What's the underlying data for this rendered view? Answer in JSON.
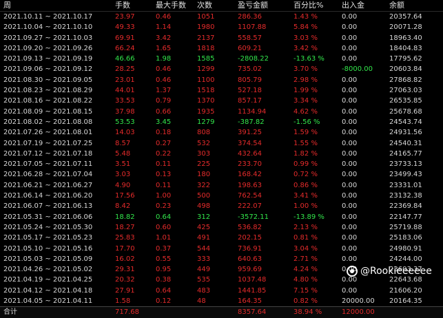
{
  "headers": [
    "周",
    "手数",
    "最大手数",
    "次数",
    "盈亏金额",
    "百分比%",
    "出入金",
    "余额"
  ],
  "rows": [
    {
      "week": "2021.10.11 ~ 2021.10.17",
      "lots": "23.97",
      "max": "0.46",
      "count": "1051",
      "pnl": "286.36",
      "pct": "1.43 %",
      "io": "0.00",
      "bal": "20357.64",
      "color": "red"
    },
    {
      "week": "2021.10.04 ~ 2021.10.10",
      "lots": "49.33",
      "max": "1.14",
      "count": "1980",
      "pnl": "1107.88",
      "pct": "5.84 %",
      "io": "0.00",
      "bal": "20071.28",
      "color": "red"
    },
    {
      "week": "2021.09.27 ~ 2021.10.03",
      "lots": "69.91",
      "max": "3.42",
      "count": "2137",
      "pnl": "558.57",
      "pct": "3.03 %",
      "io": "0.00",
      "bal": "18963.40",
      "color": "red"
    },
    {
      "week": "2021.09.20 ~ 2021.09.26",
      "lots": "66.24",
      "max": "1.65",
      "count": "1818",
      "pnl": "609.21",
      "pct": "3.42 %",
      "io": "0.00",
      "bal": "18404.83",
      "color": "red"
    },
    {
      "week": "2021.09.13 ~ 2021.09.19",
      "lots": "46.66",
      "max": "1.98",
      "count": "1585",
      "pnl": "-2808.22",
      "pct": "-13.63 %",
      "io": "0.00",
      "bal": "17795.62",
      "color": "green"
    },
    {
      "week": "2021.09.06 ~ 2021.09.12",
      "lots": "28.25",
      "max": "0.46",
      "count": "1299",
      "pnl": "735.02",
      "pct": "3.70 %",
      "io": "-8000.00",
      "bal": "20603.84",
      "color": "red",
      "io_color": "green"
    },
    {
      "week": "2021.08.30 ~ 2021.09.05",
      "lots": "23.01",
      "max": "0.46",
      "count": "1100",
      "pnl": "805.79",
      "pct": "2.98 %",
      "io": "0.00",
      "bal": "27868.82",
      "color": "red"
    },
    {
      "week": "2021.08.23 ~ 2021.08.29",
      "lots": "44.01",
      "max": "1.37",
      "count": "1518",
      "pnl": "527.18",
      "pct": "1.99 %",
      "io": "0.00",
      "bal": "27063.03",
      "color": "red"
    },
    {
      "week": "2021.08.16 ~ 2021.08.22",
      "lots": "33.53",
      "max": "0.79",
      "count": "1370",
      "pnl": "857.17",
      "pct": "3.34 %",
      "io": "0.00",
      "bal": "26535.85",
      "color": "red"
    },
    {
      "week": "2021.08.09 ~ 2021.08.15",
      "lots": "37.98",
      "max": "0.66",
      "count": "1935",
      "pnl": "1134.94",
      "pct": "4.62 %",
      "io": "0.00",
      "bal": "25678.68",
      "color": "red"
    },
    {
      "week": "2021.08.02 ~ 2021.08.08",
      "lots": "53.53",
      "max": "3.45",
      "count": "1279",
      "pnl": "-387.82",
      "pct": "-1.56 %",
      "io": "0.00",
      "bal": "24543.74",
      "color": "green"
    },
    {
      "week": "2021.07.26 ~ 2021.08.01",
      "lots": "14.03",
      "max": "0.18",
      "count": "808",
      "pnl": "391.25",
      "pct": "1.59 %",
      "io": "0.00",
      "bal": "24931.56",
      "color": "red"
    },
    {
      "week": "2021.07.19 ~ 2021.07.25",
      "lots": "8.57",
      "max": "0.27",
      "count": "532",
      "pnl": "374.54",
      "pct": "1.55 %",
      "io": "0.00",
      "bal": "24540.31",
      "color": "red"
    },
    {
      "week": "2021.07.12 ~ 2021.07.18",
      "lots": "5.48",
      "max": "0.22",
      "count": "303",
      "pnl": "432.64",
      "pct": "1.82 %",
      "io": "0.00",
      "bal": "24165.77",
      "color": "red"
    },
    {
      "week": "2021.07.05 ~ 2021.07.11",
      "lots": "3.51",
      "max": "0.11",
      "count": "225",
      "pnl": "233.70",
      "pct": "0.99 %",
      "io": "0.00",
      "bal": "23733.13",
      "color": "red"
    },
    {
      "week": "2021.06.28 ~ 2021.07.04",
      "lots": "3.03",
      "max": "0.13",
      "count": "180",
      "pnl": "168.42",
      "pct": "0.72 %",
      "io": "0.00",
      "bal": "23499.43",
      "color": "red"
    },
    {
      "week": "2021.06.21 ~ 2021.06.27",
      "lots": "4.90",
      "max": "0.11",
      "count": "322",
      "pnl": "198.63",
      "pct": "0.86 %",
      "io": "0.00",
      "bal": "23331.01",
      "color": "red"
    },
    {
      "week": "2021.06.14 ~ 2021.06.20",
      "lots": "17.56",
      "max": "1.00",
      "count": "500",
      "pnl": "762.54",
      "pct": "3.41 %",
      "io": "0.00",
      "bal": "23132.38",
      "color": "red"
    },
    {
      "week": "2021.06.07 ~ 2021.06.13",
      "lots": "8.42",
      "max": "0.23",
      "count": "498",
      "pnl": "222.07",
      "pct": "1.00 %",
      "io": "0.00",
      "bal": "22369.84",
      "color": "red"
    },
    {
      "week": "2021.05.31 ~ 2021.06.06",
      "lots": "18.82",
      "max": "0.64",
      "count": "312",
      "pnl": "-3572.11",
      "pct": "-13.89 %",
      "io": "0.00",
      "bal": "22147.77",
      "color": "green"
    },
    {
      "week": "2021.05.24 ~ 2021.05.30",
      "lots": "18.27",
      "max": "0.60",
      "count": "425",
      "pnl": "536.82",
      "pct": "2.13 %",
      "io": "0.00",
      "bal": "25719.88",
      "color": "red"
    },
    {
      "week": "2021.05.17 ~ 2021.05.23",
      "lots": "25.83",
      "max": "1.01",
      "count": "491",
      "pnl": "202.15",
      "pct": "0.81 %",
      "io": "0.00",
      "bal": "25183.06",
      "color": "red"
    },
    {
      "week": "2021.05.10 ~ 2021.05.16",
      "lots": "17.70",
      "max": "0.37",
      "count": "544",
      "pnl": "736.91",
      "pct": "3.04 %",
      "io": "0.00",
      "bal": "24980.91",
      "color": "red"
    },
    {
      "week": "2021.05.03 ~ 2021.05.09",
      "lots": "16.02",
      "max": "0.55",
      "count": "333",
      "pnl": "640.63",
      "pct": "2.71 %",
      "io": "0.00",
      "bal": "24244.00",
      "color": "red"
    },
    {
      "week": "2021.04.26 ~ 2021.05.02",
      "lots": "29.31",
      "max": "0.95",
      "count": "449",
      "pnl": "959.69",
      "pct": "4.24 %",
      "io": "0.00",
      "bal": "23603.37",
      "color": "red"
    },
    {
      "week": "2021.04.19 ~ 2021.04.25",
      "lots": "20.32",
      "max": "0.38",
      "count": "535",
      "pnl": "1037.48",
      "pct": "4.80 %",
      "io": "0.00",
      "bal": "22643.68",
      "color": "red"
    },
    {
      "week": "2021.04.12 ~ 2021.04.18",
      "lots": "27.91",
      "max": "0.64",
      "count": "483",
      "pnl": "1441.85",
      "pct": "7.15 %",
      "io": "0.00",
      "bal": "21606.20",
      "color": "red"
    },
    {
      "week": "2021.04.05 ~ 2021.04.11",
      "lots": "1.58",
      "max": "0.12",
      "count": "48",
      "pnl": "164.35",
      "pct": "0.82 %",
      "io": "20000.00",
      "bal": "20164.35",
      "color": "red"
    }
  ],
  "total": {
    "label": "合计",
    "lots": "717.68",
    "pnl": "8357.64",
    "pct": "38.94 %",
    "io": "12000.00"
  },
  "watermark": "@Rookieeeeee",
  "colors": {
    "profit": "#e52b2b",
    "loss": "#32e64b",
    "text": "#d8d8d8"
  }
}
